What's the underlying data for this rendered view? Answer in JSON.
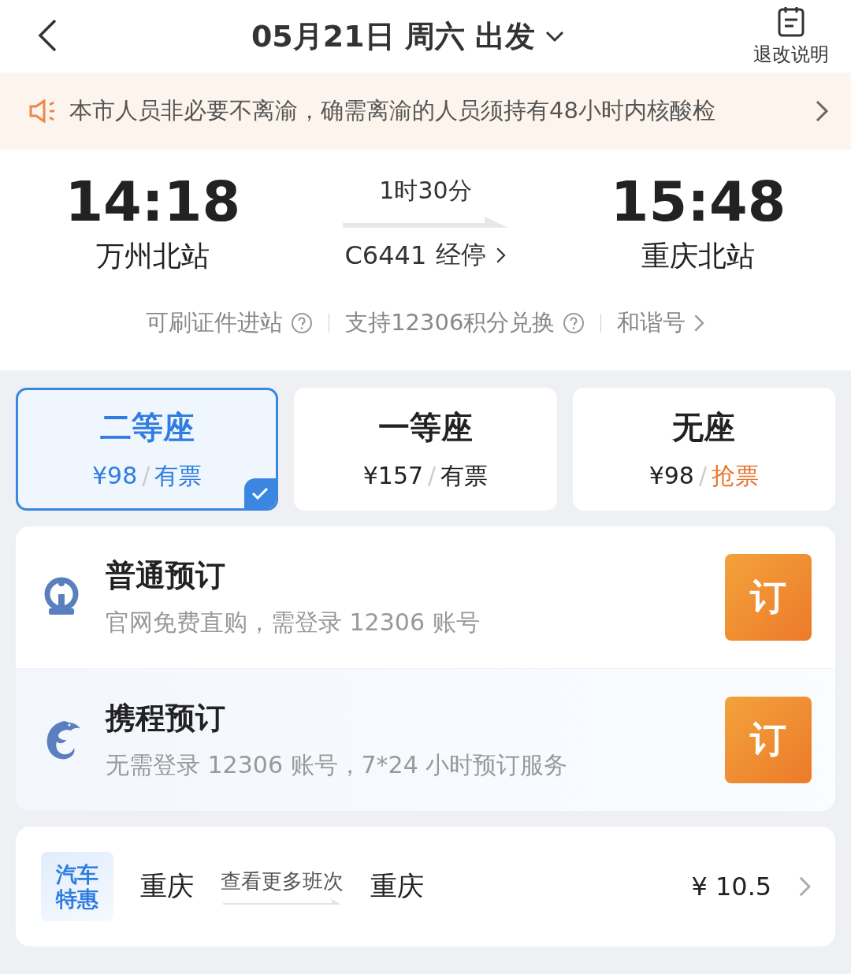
{
  "header": {
    "date": "05月21日 周六 出发",
    "policy_label": "退改说明"
  },
  "notice": {
    "text": "本市人员非必要不离渝，确需离渝的人员须持有48小时内核酸检"
  },
  "trip": {
    "depart_time": "14:18",
    "depart_station": "万州北站",
    "duration": "1时30分",
    "train": "C6441",
    "stops_label": "经停",
    "arrive_time": "15:48",
    "arrive_station": "重庆北站"
  },
  "features": [
    {
      "label": "可刷证件进站",
      "kind": "help"
    },
    {
      "label": "支持12306积分兑换",
      "kind": "help"
    },
    {
      "label": "和谐号",
      "kind": "link"
    }
  ],
  "seats": [
    {
      "name": "二等座",
      "price": "¥98",
      "separator": "/",
      "availability": "有票",
      "kind": "available",
      "selected": true
    },
    {
      "name": "一等座",
      "price": "¥157",
      "separator": "/",
      "availability": "有票",
      "kind": "available",
      "selected": false
    },
    {
      "name": "无座",
      "price": "¥98",
      "separator": "/",
      "availability": "抢票",
      "kind": "grab",
      "selected": false
    }
  ],
  "booking_options": [
    {
      "title": "普通预订",
      "description": "官网免费直购，需登录 12306 账号",
      "kind": "rail",
      "button": "订"
    },
    {
      "title": "携程预订",
      "description": "无需登录 12306 账号，7*24 小时预订服务",
      "kind": "dolphin",
      "button": "订"
    }
  ],
  "bus": {
    "badge_lines": [
      "汽车",
      "特惠"
    ],
    "from": "重庆",
    "link": "查看更多班次",
    "to": "重庆",
    "price": "¥ 10.5"
  }
}
